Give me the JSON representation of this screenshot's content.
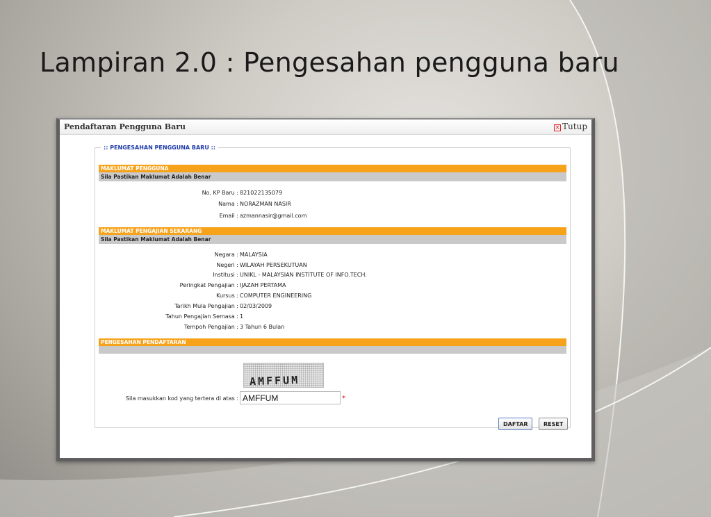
{
  "slide": {
    "title": "Lampiran 2.0 : Pengesahan pengguna baru"
  },
  "window": {
    "title": "Pendaftaran Pengguna Baru",
    "close_label": "Tutup"
  },
  "form": {
    "legend": ":: PENGESAHAN PENGGUNA BARU ::",
    "section1": {
      "header": "MAKLUMAT PENGGUNA",
      "subheader": "Sila Pastikan Maklumat Adalah Benar",
      "fields": [
        {
          "label": "No. KP Baru :",
          "value": "821022135079"
        },
        {
          "label": "Nama :",
          "value": "NORAZMAN NASIR"
        },
        {
          "label": "Email :",
          "value": "azmannasir@gmail.com"
        }
      ]
    },
    "section2": {
      "header": "MAKLUMAT PENGAJIAN SEKARANG",
      "subheader": "Sila Pastikan Maklumat Adalah Benar",
      "fields": [
        {
          "label": "Negara :",
          "value": "MALAYSIA"
        },
        {
          "label": "Negeri :",
          "value": "WILAYAH PERSEKUTUAN"
        },
        {
          "label": "Institusi :",
          "value": "UNIKL - MALAYSIAN INSTITUTE OF INFO.TECH."
        },
        {
          "label": "Peringkat Pengajian :",
          "value": "IJAZAH PERTAMA"
        },
        {
          "label": "Kursus :",
          "value": "COMPUTER ENGINEERING"
        },
        {
          "label": "Tarikh Mula Pengajian :",
          "value": "02/03/2009"
        },
        {
          "label": "Tahun Pengajian Semasa :",
          "value": "1"
        },
        {
          "label": "Tempoh Pengajian :",
          "value": "3 Tahun 6 Bulan"
        }
      ]
    },
    "section3": {
      "header": "PENGESAHAN PENDAFTARAN",
      "subheader": ""
    },
    "captcha": {
      "image_text": "AMFFUM",
      "label": "Sila masukkan kod yang tertera di atas :",
      "input_value": "AMFFUM",
      "required_mark": "*"
    },
    "buttons": {
      "submit": "DAFTAR",
      "reset": "RESET"
    }
  },
  "colors": {
    "section_bar": "#f7a21b",
    "sub_bar": "#c9c9c9",
    "legend": "#1e3aa8",
    "required": "#e01010"
  }
}
